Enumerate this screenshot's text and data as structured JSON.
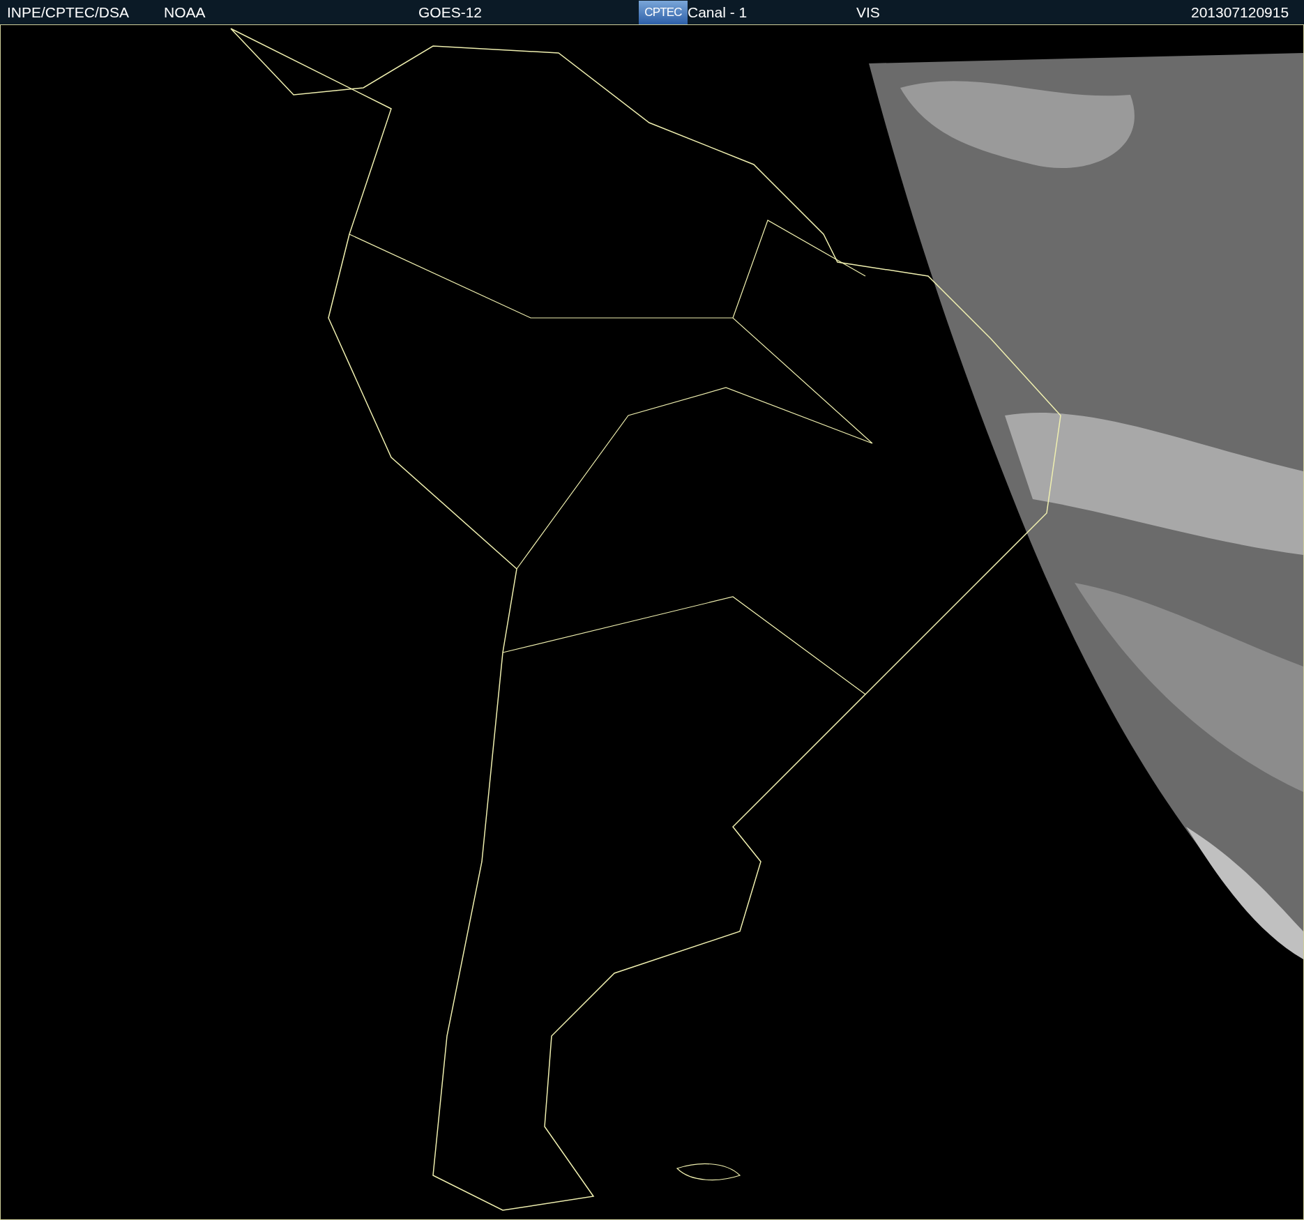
{
  "header": {
    "items": [
      {
        "text": "INPE/CPTEC/DSA"
      },
      {
        "text": "NOAA"
      },
      {
        "text": "GOES-12"
      },
      {
        "text": "CPTEC",
        "kind": "logo"
      },
      {
        "text": "Canal - 1"
      },
      {
        "text": "VIS"
      },
      {
        "text": "201307120915"
      }
    ]
  }
}
